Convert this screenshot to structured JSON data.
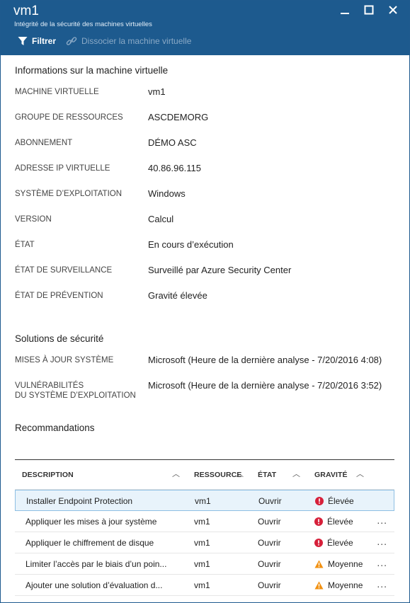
{
  "header": {
    "title": "vm1",
    "subtitle": "Intégrité de la sécurité des machines virtuelles",
    "toolbar": {
      "filter_label": "Filtrer",
      "detach_label": "Dissocier la machine virtuelle"
    }
  },
  "vm_info": {
    "section_title": "Informations sur la machine virtuelle",
    "props": [
      {
        "label": "MACHINE VIRTUELLE",
        "value": "vm1"
      },
      {
        "label": "GROUPE DE RESSOURCES",
        "value": "ASCDEMORG"
      },
      {
        "label": "ABONNEMENT",
        "value": "DÉMO ASC"
      },
      {
        "label": "ADRESSE IP VIRTUELLE",
        "value": "40.86.96.115"
      },
      {
        "label": "SYSTÈME D’EXPLOITATION",
        "value": "Windows"
      },
      {
        "label": "VERSION",
        "value": "Calcul"
      },
      {
        "label": "ÉTAT",
        "value": "En cours d’exécution"
      },
      {
        "label": "ÉTAT DE SURVEILLANCE",
        "value": "Surveillé par Azure Security Center"
      },
      {
        "label": "ÉTAT DE PRÉVENTION",
        "value": "Gravité élevée"
      }
    ]
  },
  "security_solutions": {
    "section_title": "Solutions de sécurité",
    "props": [
      {
        "label": "MISES À JOUR SYSTÈME",
        "value": "Microsoft (Heure de la dernière analyse - 7/20/2016 4:08)"
      },
      {
        "label_line1": "VULNÉRABILITÉS",
        "label_line2": "DU SYSTÈME D’EXPLOITATION",
        "value": "Microsoft (Heure de la dernière analyse - 7/20/2016 3:52)"
      }
    ]
  },
  "recommendations": {
    "section_title": "Recommandations",
    "columns": [
      "DESCRIPTION",
      "RESSOURCE",
      "ÉTAT",
      "GRAVITÉ"
    ],
    "rows": [
      {
        "description": "Installer Endpoint Protection",
        "resource": "vm1",
        "state": "Ouvrir",
        "severity": "Élevée",
        "severity_icon": "error-icon",
        "more": ""
      },
      {
        "description": "Appliquer les mises à jour système",
        "resource": "vm1",
        "state": "Ouvrir",
        "severity": "Élevée",
        "severity_icon": "error-icon",
        "more": "..."
      },
      {
        "description": "Appliquer le chiffrement de disque",
        "resource": "vm1",
        "state": "Ouvrir",
        "severity": "Élevée",
        "severity_icon": "error-icon",
        "more": "..."
      },
      {
        "description": "Limiter l’accès par le biais d’un poin...",
        "resource": "vm1",
        "state": "Ouvrir",
        "severity": "Moyenne",
        "severity_icon": "warning-icon",
        "more": "..."
      },
      {
        "description": "Ajouter une solution d’évaluation d...",
        "resource": "vm1",
        "state": "Ouvrir",
        "severity": "Moyenne",
        "severity_icon": "warning-icon",
        "more": "..."
      }
    ]
  },
  "colors": {
    "header_bg": "#1d5a8e",
    "error_red": "#d6203a",
    "warning_orange": "#f29111",
    "selected_row_bg": "#e8f3fb"
  }
}
